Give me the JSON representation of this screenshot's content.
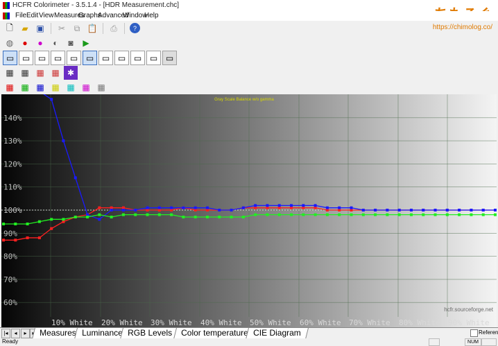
{
  "window": {
    "title": "HCFR Colorimeter - 3.5.1.4 - [HDR Measurement.chc]"
  },
  "watermark": {
    "text": "ちもろぐ",
    "url": "https://chimolog.co/"
  },
  "menu": [
    "File",
    "Edit",
    "View",
    "Measures",
    "Graphs",
    "Advanced",
    "Window",
    "Help"
  ],
  "chart_data": {
    "type": "line",
    "title": "Gray Scale Balance w/o gamma",
    "watermark": "hcfr.sourceforge.net",
    "ylim": [
      50,
      150
    ],
    "y_ticks": [
      "60%",
      "70%",
      "80%",
      "90%",
      "100%",
      "110%",
      "120%",
      "130%",
      "140%"
    ],
    "x_tick_labels": [
      "10% White",
      "20% White",
      "30% White",
      "40% White",
      "50% White",
      "60% White",
      "70% White",
      "80% White",
      "90% White"
    ],
    "x": [
      0,
      1,
      2,
      3,
      4,
      5,
      6,
      7,
      8,
      9,
      10,
      11,
      12,
      13,
      14,
      15,
      16,
      17,
      18,
      19,
      20,
      21,
      22,
      23,
      24,
      25,
      26,
      27,
      28,
      29,
      30,
      31,
      32,
      33,
      34,
      35,
      36,
      37,
      38,
      39,
      40,
      41
    ],
    "reference_value": 100,
    "series": [
      {
        "color": "#ff2020",
        "values": [
          87,
          87,
          88,
          88,
          92,
          95,
          97,
          98,
          101,
          101,
          101,
          100,
          100,
          100,
          100,
          101,
          100,
          100,
          100,
          100,
          101,
          101,
          101,
          101,
          101,
          101,
          101,
          100,
          100,
          100,
          100,
          100,
          100,
          100,
          100,
          100,
          100,
          100,
          100,
          100,
          100,
          100
        ]
      },
      {
        "color": "#1a1aff",
        "values": [
          null,
          null,
          null,
          null,
          148,
          130,
          114,
          98,
          96,
          100,
          100,
          100,
          101,
          101,
          101,
          101,
          101,
          101,
          100,
          100,
          101,
          102,
          102,
          102,
          102,
          102,
          102,
          101,
          101,
          101,
          100,
          100,
          100,
          100,
          100,
          100,
          100,
          100,
          100,
          100,
          100,
          100
        ]
      },
      {
        "color": "#22ee22",
        "values": [
          94,
          94,
          94,
          95,
          96,
          96,
          97,
          97,
          98,
          97,
          98,
          98,
          98,
          98,
          98,
          97,
          97,
          97,
          97,
          97,
          97,
          98,
          98,
          98,
          98,
          98,
          98,
          98,
          98,
          98,
          98,
          98,
          98,
          98,
          98,
          98,
          98,
          98,
          98,
          98,
          98,
          98
        ]
      }
    ]
  },
  "tabs": [
    "Measures",
    "Luminance",
    "RGB Levels",
    "Color temperature",
    "CIE Diagram"
  ],
  "active_tab": "RGB Levels",
  "reference_label": "Reference",
  "status": {
    "ready": "Ready",
    "num": "NUM"
  }
}
